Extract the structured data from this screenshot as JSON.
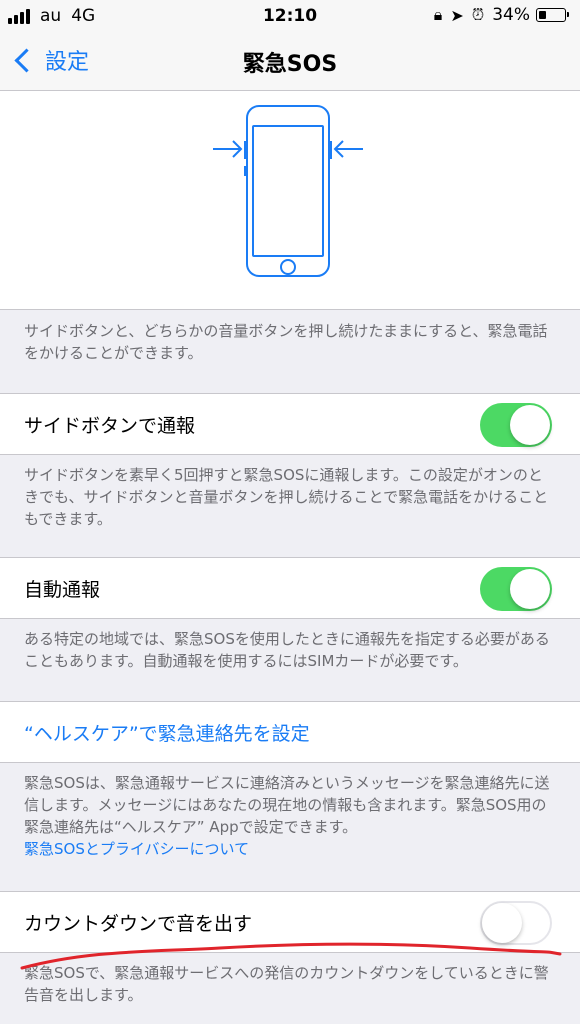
{
  "status": {
    "carrier": "au",
    "network": "4G",
    "time": "12:10",
    "battery": "34%",
    "battery_level": 0.34,
    "icons": [
      "orientation-lock-icon",
      "location-icon",
      "alarm-icon"
    ]
  },
  "nav": {
    "back_label": "設定",
    "title": "緊急SOS"
  },
  "intro_text": "サイドボタンと、どちらかの音量ボタンを押し続けたままにすると、緊急電話をかけることができます。",
  "side_button": {
    "label": "サイドボタンで通報",
    "on": true,
    "footer": "サイドボタンを素早く5回押すと緊急SOSに通報します。この設定がオンのときでも、サイドボタンと音量ボタンを押し続けることで緊急電話をかけることもできます。"
  },
  "auto_call": {
    "label": "自動通報",
    "on": true,
    "footer": "ある特定の地域では、緊急SOSを使用したときに通報先を指定する必要があることもあります。自動通報を使用するにはSIMカードが必要です。"
  },
  "health": {
    "link_label": "“ヘルスケア”で緊急連絡先を設定",
    "footer": "緊急SOSは、緊急通報サービスに連絡済みというメッセージを緊急連絡先に送信します。メッセージにはあなたの現在地の情報も含まれます。緊急SOS用の緊急連絡先は“ヘルスケア” Appで設定できます。",
    "privacy_link": "緊急SOSとプライバシーについて"
  },
  "countdown": {
    "label": "カウントダウンで音を出す",
    "on": false,
    "footer": "緊急SOSで、緊急通報サービスへの発信のカウントダウンをしているときに警告音を出します。"
  },
  "colors": {
    "accent": "#1a7cf5",
    "toggle_on": "#4cd964",
    "annotation": "#e0242b"
  }
}
